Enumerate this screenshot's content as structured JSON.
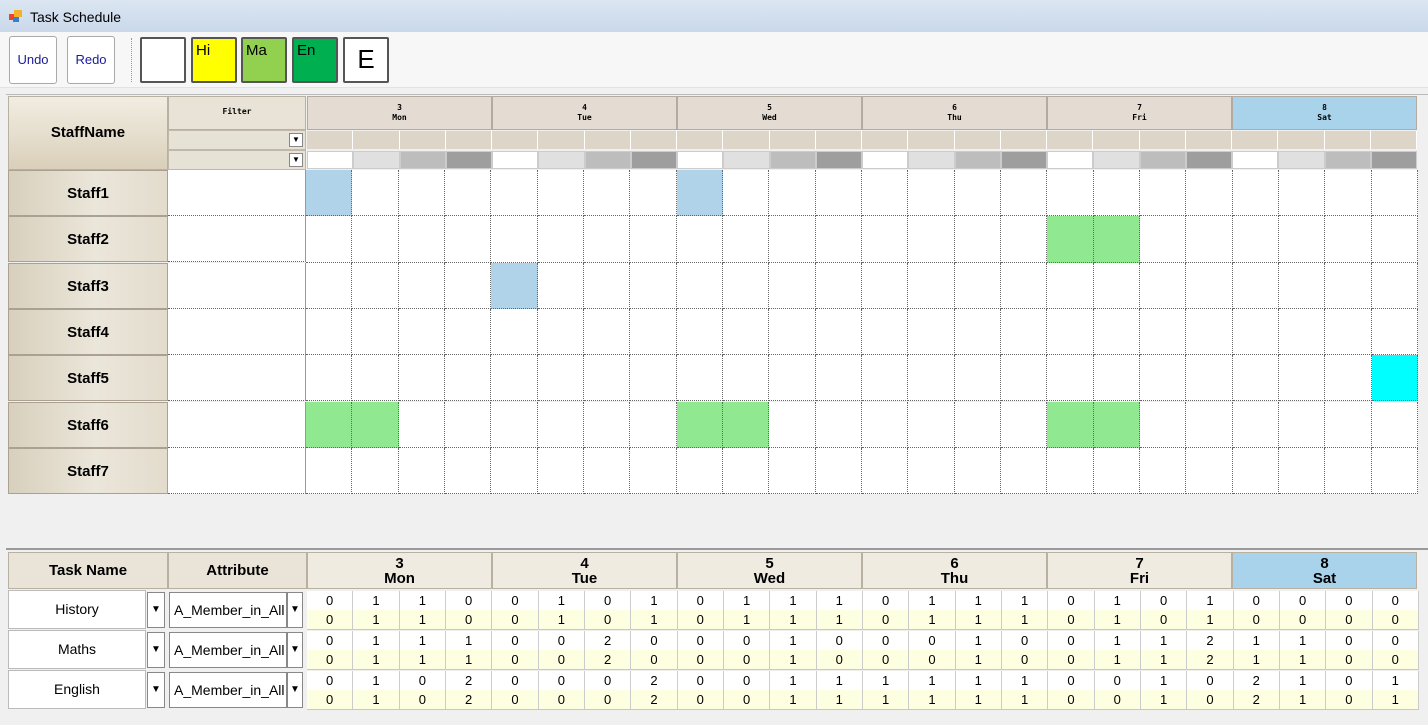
{
  "window": {
    "title": "Task Schedule"
  },
  "toolbar": {
    "undo": "Undo",
    "redo": "Redo",
    "swatches": [
      {
        "label": "",
        "color": "#ffffff"
      },
      {
        "label": "Hi",
        "color": "#ffff00"
      },
      {
        "label": "Ma",
        "color": "#92d050"
      },
      {
        "label": "En",
        "color": "#00b050"
      },
      {
        "label": "E",
        "color": "#ffffff"
      }
    ]
  },
  "schedule": {
    "staff_header": "StaffName",
    "filter_label": "Filter",
    "days": [
      {
        "num": "3",
        "name": "Mon"
      },
      {
        "num": "4",
        "name": "Tue"
      },
      {
        "num": "5",
        "name": "Wed"
      },
      {
        "num": "6",
        "name": "Thu"
      },
      {
        "num": "7",
        "name": "Fri"
      },
      {
        "num": "8",
        "name": "Sat"
      }
    ],
    "staff": [
      "Staff1",
      "Staff2",
      "Staff3",
      "Staff4",
      "Staff5",
      "Staff6",
      "Staff7"
    ],
    "assignments": [
      {
        "staff": 0,
        "slot": 0,
        "color": "#b0d3ea"
      },
      {
        "staff": 0,
        "slot": 8,
        "color": "#b0d3ea"
      },
      {
        "staff": 1,
        "slot": 16,
        "color": "#90e890"
      },
      {
        "staff": 1,
        "slot": 17,
        "color": "#90e890"
      },
      {
        "staff": 2,
        "slot": 4,
        "color": "#b0d3ea"
      },
      {
        "staff": 4,
        "slot": 23,
        "color": "#00ffff"
      },
      {
        "staff": 5,
        "slot": 0,
        "color": "#90e890"
      },
      {
        "staff": 5,
        "slot": 1,
        "color": "#90e890"
      },
      {
        "staff": 5,
        "slot": 8,
        "color": "#90e890"
      },
      {
        "staff": 5,
        "slot": 9,
        "color": "#90e890"
      },
      {
        "staff": 5,
        "slot": 16,
        "color": "#90e890"
      },
      {
        "staff": 5,
        "slot": 17,
        "color": "#90e890"
      }
    ]
  },
  "tasks": {
    "task_header": "Task Name",
    "attribute_header": "Attribute",
    "rows": [
      {
        "name": "History",
        "attribute": "A_Member_in_All",
        "top": [
          0,
          1,
          1,
          0,
          0,
          1,
          0,
          1,
          0,
          1,
          1,
          1,
          0,
          1,
          1,
          1,
          0,
          1,
          0,
          1,
          0,
          0,
          0,
          0
        ],
        "bottom": [
          0,
          1,
          1,
          0,
          0,
          1,
          0,
          1,
          0,
          1,
          1,
          1,
          0,
          1,
          1,
          1,
          0,
          1,
          0,
          1,
          0,
          0,
          0,
          0
        ]
      },
      {
        "name": "Maths",
        "attribute": "A_Member_in_All",
        "top": [
          0,
          1,
          1,
          1,
          0,
          0,
          2,
          0,
          0,
          0,
          1,
          0,
          0,
          0,
          1,
          0,
          0,
          1,
          1,
          2,
          1,
          1,
          0,
          0
        ],
        "bottom": [
          0,
          1,
          1,
          1,
          0,
          0,
          2,
          0,
          0,
          0,
          1,
          0,
          0,
          0,
          1,
          0,
          0,
          1,
          1,
          2,
          1,
          1,
          0,
          0
        ]
      },
      {
        "name": "English",
        "attribute": "A_Member_in_All",
        "top": [
          0,
          1,
          0,
          2,
          0,
          0,
          0,
          2,
          0,
          0,
          1,
          1,
          1,
          1,
          1,
          1,
          0,
          0,
          1,
          0,
          2,
          1,
          0,
          1
        ],
        "bottom": [
          0,
          1,
          0,
          2,
          0,
          0,
          0,
          2,
          0,
          0,
          1,
          1,
          1,
          1,
          1,
          1,
          0,
          0,
          1,
          0,
          2,
          1,
          0,
          1
        ]
      }
    ]
  }
}
